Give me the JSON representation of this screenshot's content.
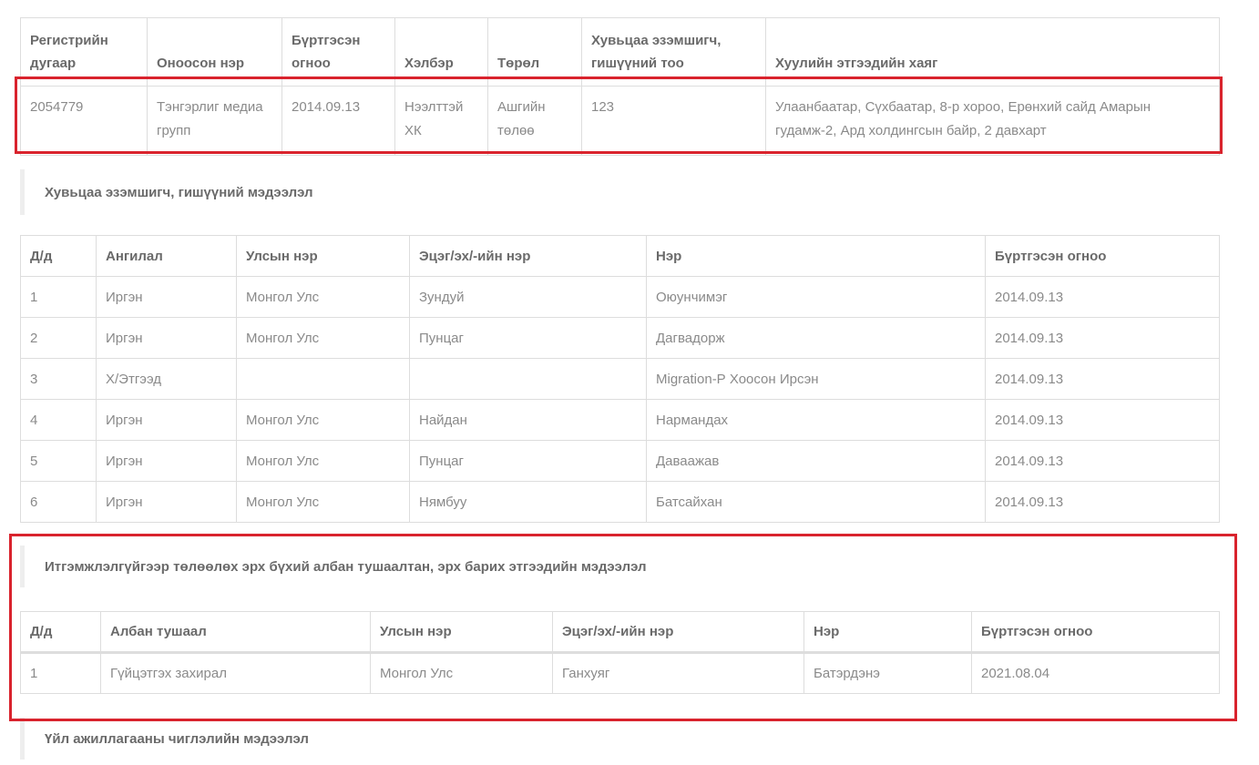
{
  "company": {
    "headers": [
      "Регистрийн дугаар",
      "Оноосон нэр",
      "Бүртгэсэн огноо",
      "Хэлбэр",
      "Төрөл",
      "Хувьцаа эзэмшигч, гишүүний тоо",
      "Хуулийн этгээдийн хаяг"
    ],
    "row": [
      "2054779",
      "Тэнгэрлиг медиа групп",
      "2014.09.13",
      "Нээлттэй ХК",
      "Ашгийн төлөө",
      "123",
      "Улаанбаатар, Сүхбаатар, 8-р хороо, Ерөнхий сайд Амарын гудамж-2, Ард холдингсын байр, 2 давхарт"
    ]
  },
  "shareholders": {
    "heading": "Хувьцаа эзэмшигч, гишүүний мэдээлэл",
    "headers": [
      "Д/д",
      "Ангилал",
      "Улсын нэр",
      "Эцэг/эх/-ийн нэр",
      "Нэр",
      "Бүртгэсэн огноо"
    ],
    "rows": [
      [
        "1",
        "Иргэн",
        "Монгол Улс",
        "Зундуй",
        "Оюунчимэг",
        "2014.09.13"
      ],
      [
        "2",
        "Иргэн",
        "Монгол Улс",
        "Пунцаг",
        "Дагвадорж",
        "2014.09.13"
      ],
      [
        "3",
        "Х/Этгээд",
        "",
        "",
        "Migration-Р Хоосон Ирсэн",
        "2014.09.13"
      ],
      [
        "4",
        "Иргэн",
        "Монгол Улс",
        "Найдан",
        "Нармандах",
        "2014.09.13"
      ],
      [
        "5",
        "Иргэн",
        "Монгол Улс",
        "Пунцаг",
        "Даваажав",
        "2014.09.13"
      ],
      [
        "6",
        "Иргэн",
        "Монгол Улс",
        "Нямбуу",
        "Батсайхан",
        "2014.09.13"
      ]
    ]
  },
  "authority": {
    "heading": "Итгэмжлэлгүйгээр төлөөлөх эрх бүхий албан тушаалтан, эрх барих этгээдийн мэдээлэл",
    "headers": [
      "Д/д",
      "Албан тушаал",
      "Улсын нэр",
      "Эцэг/эх/-ийн нэр",
      "Нэр",
      "Бүртгэсэн огноо"
    ],
    "rows": [
      [
        "1",
        "Гүйцэтгэх захирал",
        "Монгол Улс",
        "Ганхуяг",
        "Батэрдэнэ",
        "2021.08.04"
      ]
    ]
  },
  "activity": {
    "heading": "Үйл ажиллагааны чиглэлийн мэдээлэл"
  },
  "colors": {
    "highlight_border": "#d9232d",
    "table_border": "#dddddd"
  }
}
